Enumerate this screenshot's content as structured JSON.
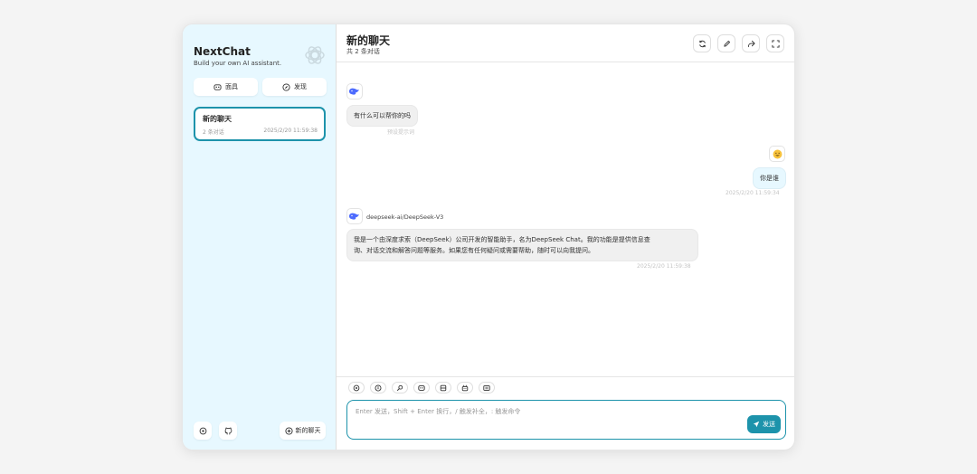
{
  "sidebar": {
    "brand_title": "NextChat",
    "brand_subtitle": "Build your own AI assistant.",
    "mask_button": "面具",
    "discover_button": "发现",
    "chats": [
      {
        "title": "新的聊天",
        "count": "2 条对话",
        "date": "2025/2/20 11:59:38"
      }
    ],
    "new_chat_button": "新的聊天"
  },
  "header": {
    "title": "新的聊天",
    "subtitle": "共 2 条对话"
  },
  "messages": {
    "bot_greeting": "有什么可以帮你的吗",
    "bot_greeting_meta": "预设提示词",
    "user_text": "你是谁",
    "user_time": "2025/2/20 11:59:34",
    "model_name": "deepseek-ai/DeepSeek-V3",
    "bot_reply_line1": "我是一个由深度求索（DeepSeek）公司开发的智能助手，名为DeepSeek Chat。我的功能是提供信息查",
    "bot_reply_line2": "询、对话交流和解答问题等服务。如果您有任何疑问或需要帮助，随时可以向我提问。",
    "bot_reply_time": "2025/2/20 11:59:38"
  },
  "composer": {
    "placeholder": "Enter 发送，Shift + Enter 换行，/ 触发补全，: 触发命令",
    "send_label": "发送"
  },
  "colors": {
    "accent": "#1d93ab",
    "sidebar_bg": "#e7f8ff"
  }
}
